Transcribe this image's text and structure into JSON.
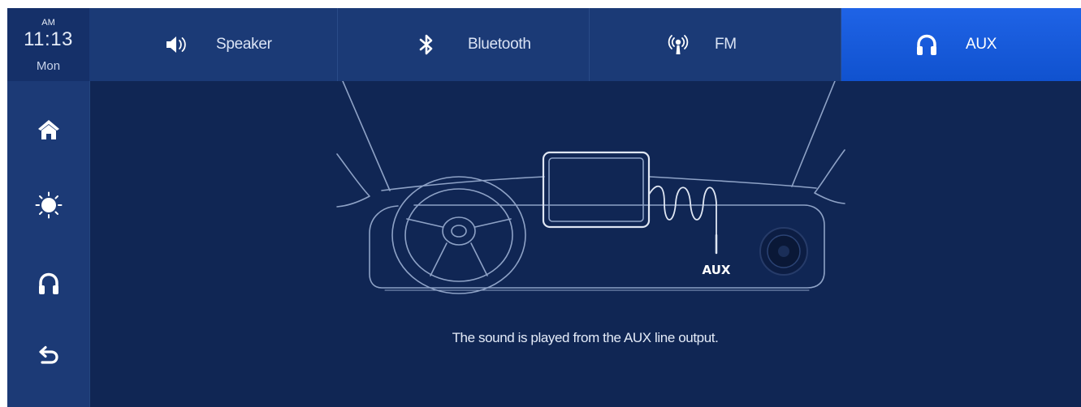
{
  "clock": {
    "ampm": "AM",
    "time": "11:13",
    "day": "Mon"
  },
  "sidebar": {
    "items": [
      {
        "name": "home",
        "icon": "home-icon"
      },
      {
        "name": "brightness",
        "icon": "brightness-icon"
      },
      {
        "name": "audio",
        "icon": "headphones-icon"
      },
      {
        "name": "back",
        "icon": "back-icon"
      }
    ]
  },
  "tabs": [
    {
      "label": "Speaker",
      "icon": "speaker-icon",
      "active": false
    },
    {
      "label": "Bluetooth",
      "icon": "bluetooth-icon",
      "active": false
    },
    {
      "label": "FM",
      "icon": "radio-icon",
      "active": false
    },
    {
      "label": "AUX",
      "icon": "headphones-icon",
      "active": true
    }
  ],
  "illustration": {
    "aux_label": "AUX"
  },
  "message": "The sound is played from the AUX line output.",
  "colors": {
    "background": "#102654",
    "sidebar": "#1c3a76",
    "tab_active": "#1a5ddf",
    "line_art": "#8ea2c6"
  }
}
